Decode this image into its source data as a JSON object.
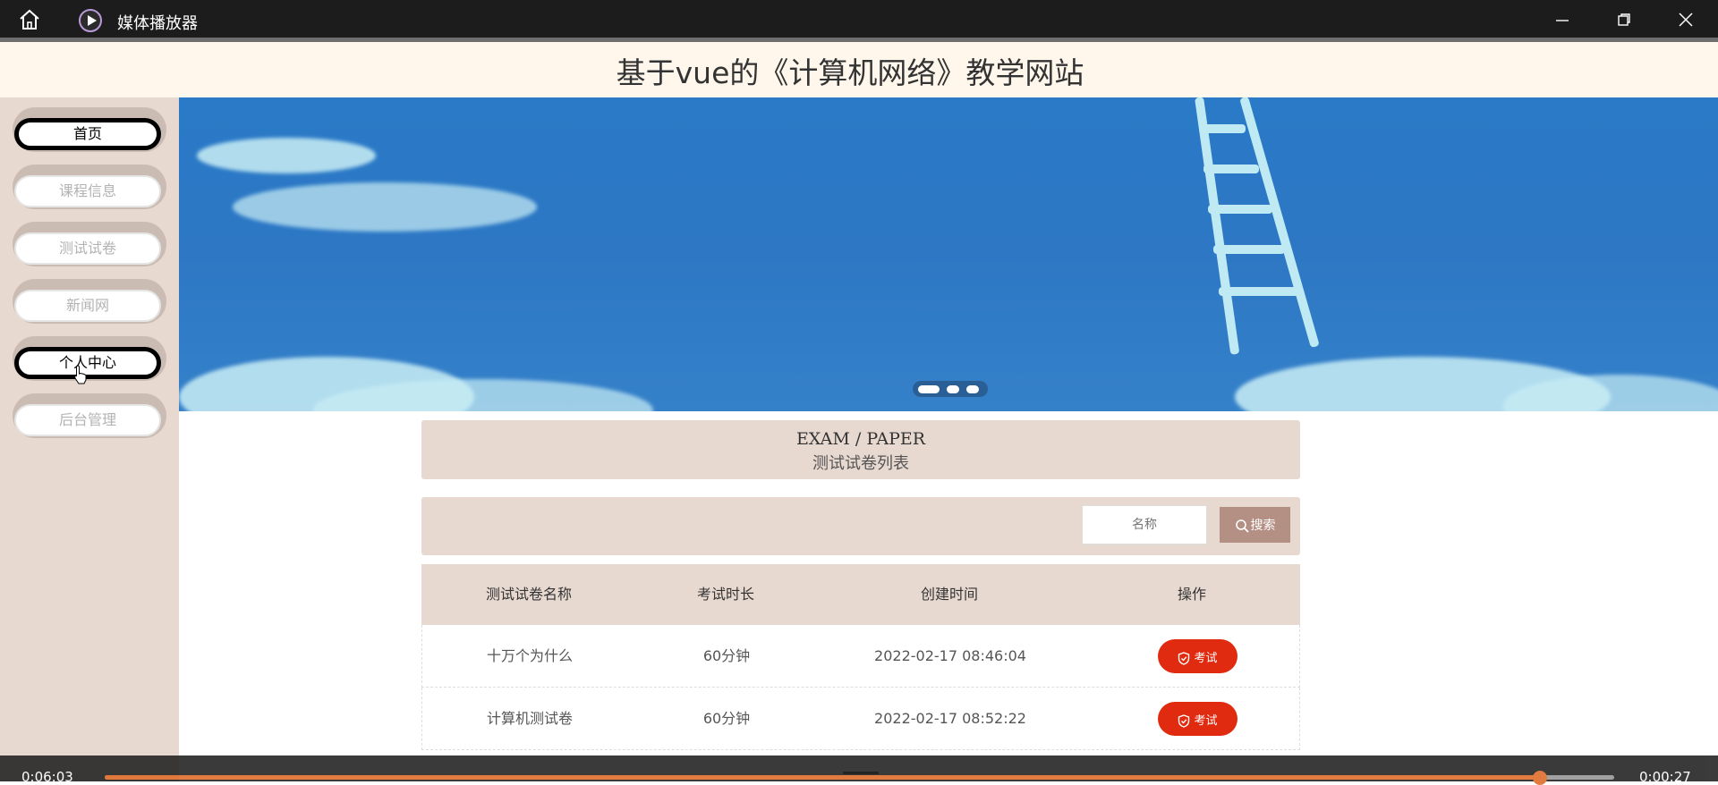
{
  "player": {
    "app_title": "媒体播放器",
    "time_elapsed": "0:06:03",
    "time_remaining": "0:00:27",
    "progress": 0.951
  },
  "site": {
    "title": "基于vue的《计算机网络》教学网站"
  },
  "sidebar": {
    "items": [
      {
        "label": "首页",
        "active": true
      },
      {
        "label": "课程信息",
        "active": false
      },
      {
        "label": "测试试卷",
        "active": false
      },
      {
        "label": "新闻网",
        "active": false
      },
      {
        "label": "个人中心",
        "active": true
      },
      {
        "label": "后台管理",
        "active": false
      }
    ]
  },
  "banner": {
    "slide_count": 3,
    "active_slide": 1
  },
  "section": {
    "title_en": "EXAM / PAPER",
    "title_cn": "测试试卷列表"
  },
  "search": {
    "placeholder": "名称",
    "button_label": "搜索"
  },
  "table": {
    "columns": [
      "测试试卷名称",
      "考试时长",
      "创建时间",
      "操作"
    ],
    "rows": [
      {
        "name": "十万个为什么",
        "duration": "60分钟",
        "created": "2022-02-17 08:46:04",
        "action": "考试"
      },
      {
        "name": "计算机测试卷",
        "duration": "60分钟",
        "created": "2022-02-17 08:52:22",
        "action": "考试"
      }
    ]
  },
  "colors": {
    "accent": "#e8d9d0",
    "exam_button": "#e02b10",
    "search_button": "#b48f84",
    "progress": "#e07030"
  },
  "icons": [
    "home-icon",
    "media-player-icon",
    "minimize-icon",
    "maximize-icon",
    "close-icon",
    "search-icon",
    "shield-check-icon",
    "hand-cursor-icon"
  ]
}
